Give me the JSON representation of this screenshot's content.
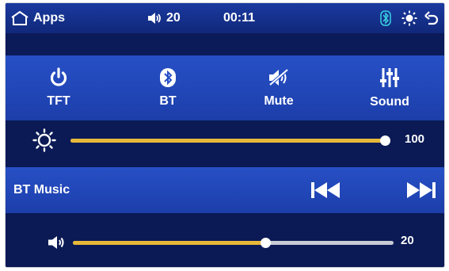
{
  "status_bar": {
    "apps_label": "Apps",
    "volume_level": "20",
    "clock": "00:11",
    "icons": [
      "home-icon",
      "speaker-icon",
      "bluetooth-icon",
      "brightness-icon",
      "back-icon"
    ]
  },
  "quick_buttons": [
    {
      "label": "TFT",
      "icon": "power-icon"
    },
    {
      "label": "BT",
      "icon": "bluetooth-icon"
    },
    {
      "label": "Mute",
      "icon": "mute-icon"
    },
    {
      "label": "Sound",
      "icon": "equalizer-icon"
    }
  ],
  "brightness": {
    "icon": "brightness-icon",
    "value": 100,
    "value_label": "100",
    "max": 100
  },
  "bt_music": {
    "label": "BT Music",
    "controls": [
      "previous-track-icon",
      "next-track-icon"
    ]
  },
  "volume": {
    "icon": "speaker-icon",
    "fraction": 0.6,
    "value_label": "20"
  },
  "colors": {
    "panel_blue": "#2750c6",
    "background_navy": "#0b1a55",
    "slider_fill": "#e8b83a",
    "slider_track": "#c7cbd6",
    "bluetooth_accent": "#3ad0e0"
  }
}
